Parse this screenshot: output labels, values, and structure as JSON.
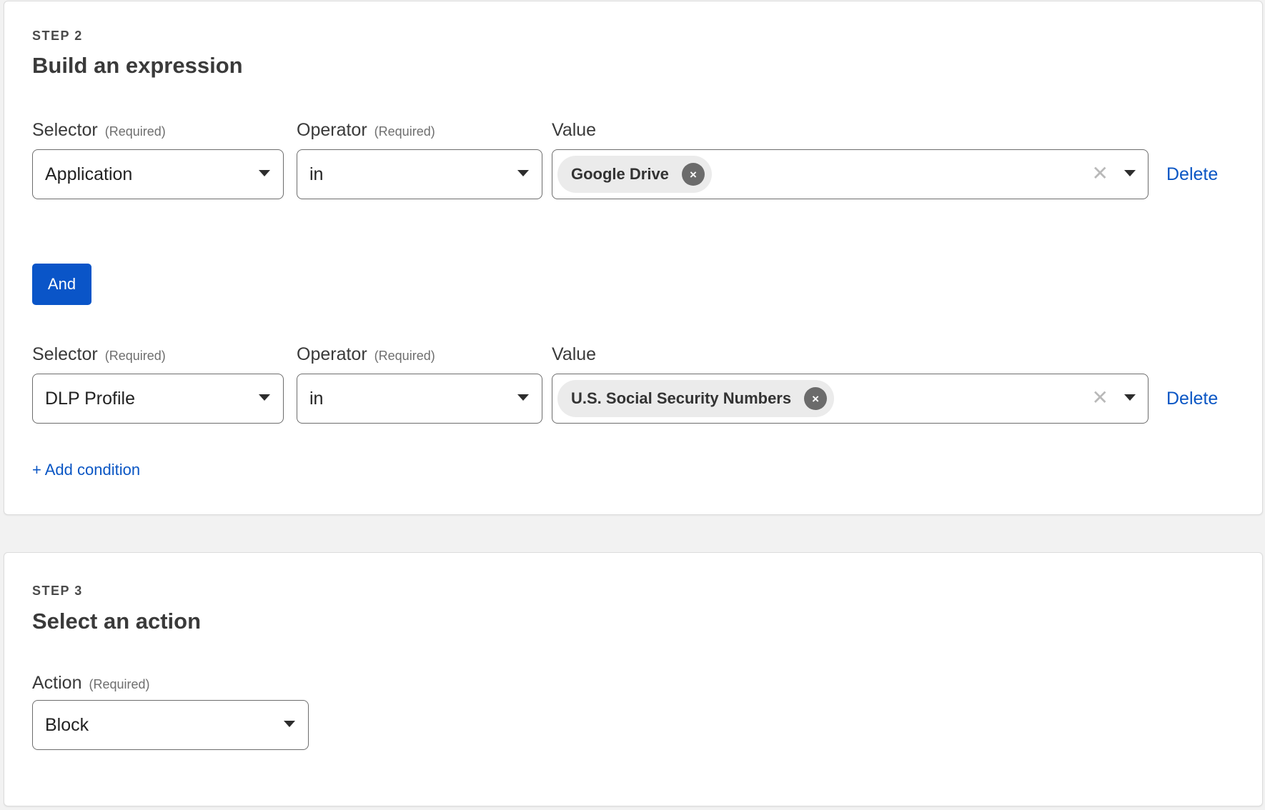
{
  "step2": {
    "step_label": "STEP 2",
    "title": "Build an expression",
    "conditions": [
      {
        "selector_label": "Selector",
        "selector_required": "(Required)",
        "selector_value": "Application",
        "operator_label": "Operator",
        "operator_required": "(Required)",
        "operator_value": "in",
        "value_label": "Value",
        "value_chip": "Google Drive",
        "delete_label": "Delete"
      },
      {
        "selector_label": "Selector",
        "selector_required": "(Required)",
        "selector_value": "DLP Profile",
        "operator_label": "Operator",
        "operator_required": "(Required)",
        "operator_value": "in",
        "value_label": "Value",
        "value_chip": "U.S. Social Security Numbers",
        "delete_label": "Delete"
      }
    ],
    "and_button": "And",
    "add_condition": "+ Add condition"
  },
  "step3": {
    "step_label": "STEP 3",
    "title": "Select an action",
    "action_label": "Action",
    "action_required": "(Required)",
    "action_value": "Block"
  },
  "icons": {
    "chip_remove": "×",
    "clear": "✕"
  },
  "colors": {
    "accent": "#0a55c8",
    "link": "#0a56c4",
    "page_background": "#f2f2f2",
    "chip_background": "#ebebeb"
  }
}
